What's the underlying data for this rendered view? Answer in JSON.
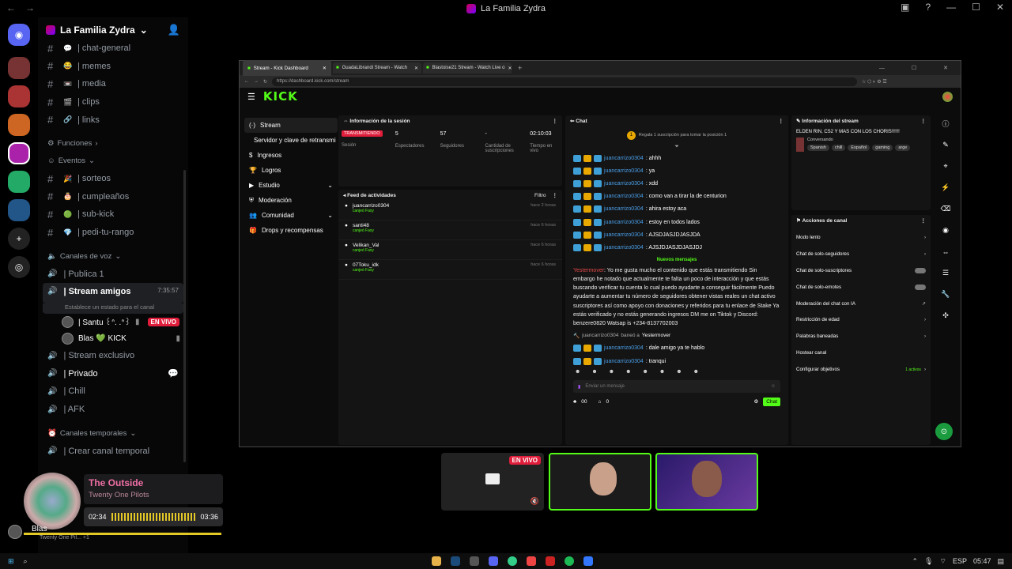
{
  "window": {
    "title": "La Familia Zydra"
  },
  "server": {
    "name": "La Familia Zydra"
  },
  "channels": [
    {
      "emoji": "💬",
      "name": "| chat-general"
    },
    {
      "emoji": "😂",
      "name": "| memes"
    },
    {
      "emoji": "📼",
      "name": "| media"
    },
    {
      "emoji": "🎬",
      "name": "| clips"
    },
    {
      "emoji": "🔗",
      "name": "| links"
    }
  ],
  "categories": {
    "funciones": "Funciones",
    "eventos": "Eventos",
    "voz": "Canales de voz",
    "temporales": "Canales temporales"
  },
  "event_channels": [
    {
      "emoji": "🎉",
      "name": "| sorteos"
    },
    {
      "emoji": "🎂",
      "name": "| cumpleaños"
    },
    {
      "emoji": "🟢",
      "name": "| sub-kick"
    },
    {
      "emoji": "💎",
      "name": "| pedi-tu-rango"
    }
  ],
  "voice": {
    "publica": "| Publica 1",
    "active": {
      "name": "| Stream amigos",
      "time": "7:35:57",
      "status": "Establece un estado para el canal"
    },
    "members": [
      {
        "name": "| Santu ꒰ᐢ. .ᐢ꒱",
        "live": "EN VIVO"
      },
      {
        "name": "Blas 💚 KICK"
      }
    ],
    "others": [
      "| Stream exclusivo",
      "| Privado",
      "| Chill",
      "| AFK"
    ],
    "temp": "| Crear canal temporal"
  },
  "now_playing": {
    "song": "The Outside",
    "artist": "Twenty One Pilots",
    "elapsed": "02:34",
    "total": "03:36",
    "user": "Blas",
    "user_sub": "Twenty One Pil... +1"
  },
  "browser": {
    "tabs": [
      "Stream - Kick Dashboard",
      "GuadaLibrandi Stream - Watch",
      "Blastoise21 Stream - Watch Live o"
    ],
    "url": "https://dashboard.kick.com/stream"
  },
  "kick": {
    "logo": "KICK",
    "nav": [
      "Stream",
      "Servidor y clave de retransmi",
      "Ingresos",
      "Logros",
      "Estudio",
      "Moderación",
      "Comunidad",
      "Drops y recompensas"
    ],
    "session": {
      "title": "Información de la sesión",
      "status": "TRANSMITIENDO",
      "status_label": "Sesión",
      "viewers": "5",
      "viewers_label": "Espectadores",
      "followers": "57",
      "followers_label": "Seguidores",
      "subs": "-",
      "subs_label": "Cantidad de suscripciones",
      "time": "02:10:03",
      "time_label": "Tiempo en vivo"
    },
    "feed": {
      "title": "Feed de actividades",
      "filter": "Filtro",
      "items": [
        {
          "user": "juancarrizo0304",
          "action": "canjeó Faxy",
          "time": "hace 2 horas"
        },
        {
          "user": "santi48",
          "action": "canjeó Faxy",
          "time": "hace 6 horas"
        },
        {
          "user": "Velikan_Val",
          "action": "canjeó Faxy",
          "time": "hace 6 horas"
        },
        {
          "user": "07Toku_idk",
          "action": "canjeó Faxy",
          "time": "hace 6 horas"
        }
      ]
    },
    "chat": {
      "title": "Chat",
      "banner": "Regala 1 suscripción para tomar la posición 1",
      "messages": [
        {
          "user": "juancarrizo0304",
          "text": ": ahhh"
        },
        {
          "user": "juancarrizo0304",
          "text": ": ya"
        },
        {
          "user": "juancarrizo0304",
          "text": ": xdd"
        },
        {
          "user": "juancarrizo0304",
          "text": ": como van a tirar la de centurion"
        },
        {
          "user": "juancarrizo0304",
          "text": ": ahira estoy aca"
        },
        {
          "user": "juancarrizo0304",
          "text": ": estoy en todos lados"
        },
        {
          "user": "juancarrizo0304",
          "text": ": AJSDJASJDJASJDA"
        },
        {
          "user": "juancarrizo0304",
          "text": ": AJSJDJASJDJASJDJ"
        }
      ],
      "new_label": "Nuevos mensajes",
      "long_user": "Yestermover",
      "long_text": ": Yo me gusta mucho el contenido que estás transmitiendo Sin embargo he notado que actualmente te falta un poco de interacción y que estás buscando verificar tu cuenta lo cual puedo ayudarte a conseguir fácilmente Puedo ayudarte a aumentar tu número de seguidores obtener vistas reales un chat activo suscriptores así como apoyo con donaciones y referidos para tu enlace de Stake Ya estás verificado y no estás generando ingresos DM me on Tiktok y Discord: benzere0820 Watsap is +234-8137702003",
      "ban": {
        "user": "juancarrizo0304",
        "verb": "baneó a",
        "target": "Yestermover"
      },
      "after": [
        {
          "user": "juancarrizo0304",
          "text": ": dale amigo ya te hablo"
        },
        {
          "user": "juancarrizo0304",
          "text": ": tranqui"
        }
      ],
      "input_placeholder": "Enviar un mensaje",
      "count_a": "00",
      "count_b": "0",
      "send": "Chat"
    },
    "stream_info": {
      "title": "Información del stream",
      "stream_title": "ELDEN RIN, CS2 Y MAS CON LOS CHORIS!!!!!!",
      "category": "Conversando",
      "tags": [
        "Spanish",
        "chill",
        "Español",
        "gaming",
        "arge"
      ]
    },
    "actions": {
      "title": "Acciones de canal",
      "items": [
        {
          "label": "Modo lento",
          "kind": "arrow"
        },
        {
          "label": "Chat de solo-seguidores",
          "kind": "arrow"
        },
        {
          "label": "Chat de solo-suscriptores",
          "kind": "toggle"
        },
        {
          "label": "Chat de solo-emotes",
          "kind": "toggle"
        },
        {
          "label": "Moderación del chat con IA",
          "kind": "ext"
        },
        {
          "label": "Restricción de edad",
          "kind": "arrow"
        },
        {
          "label": "Palabras baneadas",
          "kind": "arrow"
        },
        {
          "label": "Hostear canal",
          "kind": "none"
        },
        {
          "label": "Configurar objetivos",
          "kind": "arrow",
          "extra": "1 activos"
        }
      ]
    }
  },
  "preview": {
    "live": "EN VIVO"
  },
  "taskbar": {
    "lang": "ESP",
    "time": "05:47"
  },
  "colors": {
    "kick_green": "#53fc18",
    "live_red": "#e01e3c",
    "music_pink": "#f06fa6"
  }
}
